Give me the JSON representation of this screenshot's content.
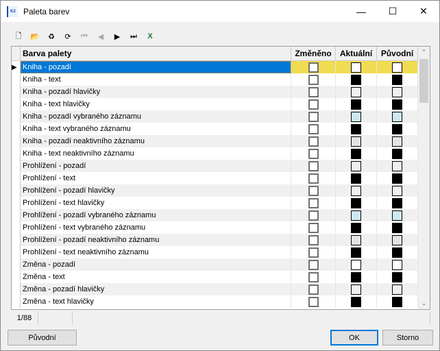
{
  "window": {
    "title": "Paleta barev",
    "app_icon_text": "K2",
    "minimize": "—",
    "maximize": "☐",
    "close": "✕"
  },
  "toolbar": [
    {
      "name": "new-icon",
      "glyph": "🗋",
      "enabled": true
    },
    {
      "name": "open-folder-icon",
      "glyph": "📂",
      "enabled": true
    },
    {
      "name": "recycle-icon",
      "glyph": "♻",
      "enabled": true
    },
    {
      "name": "refresh-icon",
      "glyph": "⟳",
      "enabled": true
    },
    {
      "name": "first-record-icon",
      "glyph": "⏮",
      "enabled": false
    },
    {
      "name": "previous-record-icon",
      "glyph": "◀",
      "enabled": false
    },
    {
      "name": "next-record-icon",
      "glyph": "▶",
      "enabled": true
    },
    {
      "name": "last-record-icon",
      "glyph": "⏭",
      "enabled": true
    },
    {
      "name": "excel-export-icon",
      "glyph": "X",
      "enabled": true
    }
  ],
  "grid": {
    "columns": [
      "Barva palety",
      "Změněno",
      "Aktuální",
      "Původní"
    ],
    "rows": [
      {
        "name": "Kniha - pozadí",
        "current": "#ffffff",
        "original": "#ffffff"
      },
      {
        "name": "Kniha - text",
        "current": "#000000",
        "original": "#000000"
      },
      {
        "name": "Kniha - pozadí hlavičky",
        "current": "#f0f0f0",
        "original": "#f0f0f0"
      },
      {
        "name": "Kniha - text hlavičky",
        "current": "#000000",
        "original": "#000000"
      },
      {
        "name": "Kniha - pozadí vybraného záznamu",
        "current": "#cce8f4",
        "original": "#cce8f4"
      },
      {
        "name": "Kniha - text vybraného záznamu",
        "current": "#000000",
        "original": "#000000"
      },
      {
        "name": "Kniha - pozadí neaktivního záznamu",
        "current": "#e3e3e3",
        "original": "#e3e3e3"
      },
      {
        "name": "Kniha - text neaktivního záznamu",
        "current": "#000000",
        "original": "#000000"
      },
      {
        "name": "Prohlížení - pozadí",
        "current": "#f0f0f0",
        "original": "#f0f0f0"
      },
      {
        "name": "Prohlížení - text",
        "current": "#000000",
        "original": "#000000"
      },
      {
        "name": "Prohlížení - pozadí hlavičky",
        "current": "#f0f0f0",
        "original": "#f0f0f0"
      },
      {
        "name": "Prohlížení - text hlavičky",
        "current": "#000000",
        "original": "#000000"
      },
      {
        "name": "Prohlížení - pozadí vybraného záznamu",
        "current": "#cce8f4",
        "original": "#cce8f4"
      },
      {
        "name": "Prohlížení - text vybraného záznamu",
        "current": "#000000",
        "original": "#000000"
      },
      {
        "name": "Prohlížení - pozadí neaktivního záznamu",
        "current": "#e3e3e3",
        "original": "#e3e3e3"
      },
      {
        "name": "Prohlížení - text neaktivního záznamu",
        "current": "#000000",
        "original": "#000000"
      },
      {
        "name": "Změna - pozadí",
        "current": "#ffffff",
        "original": "#ffffff"
      },
      {
        "name": "Změna - text",
        "current": "#000000",
        "original": "#000000"
      },
      {
        "name": "Změna - pozadí hlavičky",
        "current": "#f0f0f0",
        "original": "#f0f0f0"
      },
      {
        "name": "Změna - text hlavičky",
        "current": "#000000",
        "original": "#000000"
      }
    ]
  },
  "status": {
    "record": "1/88"
  },
  "buttons": {
    "original": "Původní",
    "ok": "OK",
    "cancel": "Storno"
  }
}
